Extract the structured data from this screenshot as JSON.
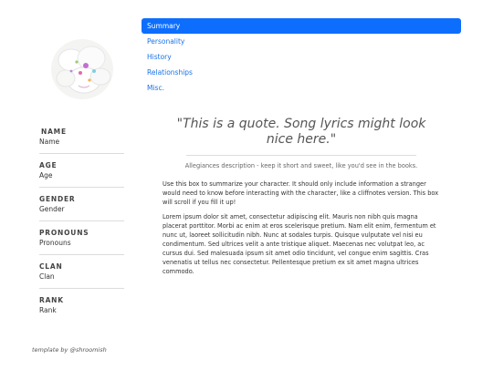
{
  "sidebar": {
    "stats": [
      {
        "label": "NAME",
        "value": "Name"
      },
      {
        "label": "AGE",
        "value": "Age"
      },
      {
        "label": "GENDER",
        "value": "Gender"
      },
      {
        "label": "PRONOUNS",
        "value": "Pronouns"
      },
      {
        "label": "CLAN",
        "value": "Clan"
      },
      {
        "label": "RANK",
        "value": "Rank"
      }
    ]
  },
  "nav": {
    "items": [
      {
        "label": "Summary",
        "active": true
      },
      {
        "label": "Personality",
        "active": false
      },
      {
        "label": "History",
        "active": false
      },
      {
        "label": "Relationships",
        "active": false
      },
      {
        "label": "Misc.",
        "active": false
      }
    ]
  },
  "main": {
    "quote": "\"This is a quote. Song lyrics might look nice here.\"",
    "allegiances": "Allegiances description - keep it short and sweet, like you'd see in the books.",
    "paragraphs": [
      "Use this box to summarize your character. It should only include information a stranger would need to know before interacting with the character, like a cliffnotes version. This box will scroll if you fill it up!",
      "Lorem ipsum dolor sit amet, consectetur adipiscing elit. Mauris non nibh quis magna placerat porttitor. Morbi ac enim at eros scelerisque pretium. Nam elit enim, fermentum et nunc ut, laoreet sollicitudin nibh. Nunc at sodales turpis. Quisque vulputate vel nisi eu condimentum. Sed ultrices velit a ante tristique aliquet. Maecenas nec volutpat leo, ac cursus dui. Sed malesuada ipsum sit amet odio tincidunt, vel congue enim sagittis. Cras venenatis ut tellus nec consectetur. Pellentesque pretium ex sit amet magna ultrices commodo."
    ]
  },
  "footer": {
    "credit": "template by @shroomish"
  },
  "colors": {
    "accent": "#0d6efd",
    "link": "#1a73e8"
  }
}
